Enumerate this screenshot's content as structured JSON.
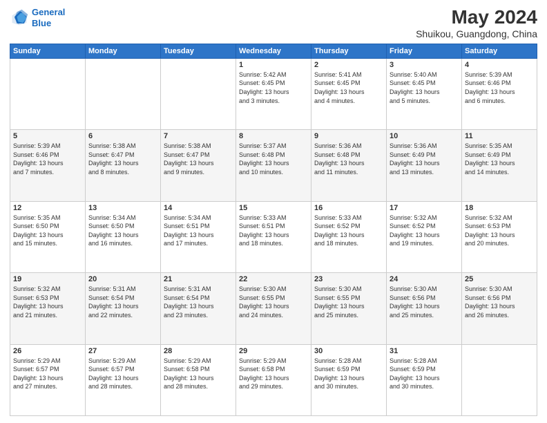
{
  "logo": {
    "line1": "General",
    "line2": "Blue"
  },
  "title": "May 2024",
  "subtitle": "Shuikou, Guangdong, China",
  "days_header": [
    "Sunday",
    "Monday",
    "Tuesday",
    "Wednesday",
    "Thursday",
    "Friday",
    "Saturday"
  ],
  "weeks": [
    [
      {
        "day": "",
        "info": ""
      },
      {
        "day": "",
        "info": ""
      },
      {
        "day": "",
        "info": ""
      },
      {
        "day": "1",
        "info": "Sunrise: 5:42 AM\nSunset: 6:45 PM\nDaylight: 13 hours\nand 3 minutes."
      },
      {
        "day": "2",
        "info": "Sunrise: 5:41 AM\nSunset: 6:45 PM\nDaylight: 13 hours\nand 4 minutes."
      },
      {
        "day": "3",
        "info": "Sunrise: 5:40 AM\nSunset: 6:45 PM\nDaylight: 13 hours\nand 5 minutes."
      },
      {
        "day": "4",
        "info": "Sunrise: 5:39 AM\nSunset: 6:46 PM\nDaylight: 13 hours\nand 6 minutes."
      }
    ],
    [
      {
        "day": "5",
        "info": "Sunrise: 5:39 AM\nSunset: 6:46 PM\nDaylight: 13 hours\nand 7 minutes."
      },
      {
        "day": "6",
        "info": "Sunrise: 5:38 AM\nSunset: 6:47 PM\nDaylight: 13 hours\nand 8 minutes."
      },
      {
        "day": "7",
        "info": "Sunrise: 5:38 AM\nSunset: 6:47 PM\nDaylight: 13 hours\nand 9 minutes."
      },
      {
        "day": "8",
        "info": "Sunrise: 5:37 AM\nSunset: 6:48 PM\nDaylight: 13 hours\nand 10 minutes."
      },
      {
        "day": "9",
        "info": "Sunrise: 5:36 AM\nSunset: 6:48 PM\nDaylight: 13 hours\nand 11 minutes."
      },
      {
        "day": "10",
        "info": "Sunrise: 5:36 AM\nSunset: 6:49 PM\nDaylight: 13 hours\nand 13 minutes."
      },
      {
        "day": "11",
        "info": "Sunrise: 5:35 AM\nSunset: 6:49 PM\nDaylight: 13 hours\nand 14 minutes."
      }
    ],
    [
      {
        "day": "12",
        "info": "Sunrise: 5:35 AM\nSunset: 6:50 PM\nDaylight: 13 hours\nand 15 minutes."
      },
      {
        "day": "13",
        "info": "Sunrise: 5:34 AM\nSunset: 6:50 PM\nDaylight: 13 hours\nand 16 minutes."
      },
      {
        "day": "14",
        "info": "Sunrise: 5:34 AM\nSunset: 6:51 PM\nDaylight: 13 hours\nand 17 minutes."
      },
      {
        "day": "15",
        "info": "Sunrise: 5:33 AM\nSunset: 6:51 PM\nDaylight: 13 hours\nand 18 minutes."
      },
      {
        "day": "16",
        "info": "Sunrise: 5:33 AM\nSunset: 6:52 PM\nDaylight: 13 hours\nand 18 minutes."
      },
      {
        "day": "17",
        "info": "Sunrise: 5:32 AM\nSunset: 6:52 PM\nDaylight: 13 hours\nand 19 minutes."
      },
      {
        "day": "18",
        "info": "Sunrise: 5:32 AM\nSunset: 6:53 PM\nDaylight: 13 hours\nand 20 minutes."
      }
    ],
    [
      {
        "day": "19",
        "info": "Sunrise: 5:32 AM\nSunset: 6:53 PM\nDaylight: 13 hours\nand 21 minutes."
      },
      {
        "day": "20",
        "info": "Sunrise: 5:31 AM\nSunset: 6:54 PM\nDaylight: 13 hours\nand 22 minutes."
      },
      {
        "day": "21",
        "info": "Sunrise: 5:31 AM\nSunset: 6:54 PM\nDaylight: 13 hours\nand 23 minutes."
      },
      {
        "day": "22",
        "info": "Sunrise: 5:30 AM\nSunset: 6:55 PM\nDaylight: 13 hours\nand 24 minutes."
      },
      {
        "day": "23",
        "info": "Sunrise: 5:30 AM\nSunset: 6:55 PM\nDaylight: 13 hours\nand 25 minutes."
      },
      {
        "day": "24",
        "info": "Sunrise: 5:30 AM\nSunset: 6:56 PM\nDaylight: 13 hours\nand 25 minutes."
      },
      {
        "day": "25",
        "info": "Sunrise: 5:30 AM\nSunset: 6:56 PM\nDaylight: 13 hours\nand 26 minutes."
      }
    ],
    [
      {
        "day": "26",
        "info": "Sunrise: 5:29 AM\nSunset: 6:57 PM\nDaylight: 13 hours\nand 27 minutes."
      },
      {
        "day": "27",
        "info": "Sunrise: 5:29 AM\nSunset: 6:57 PM\nDaylight: 13 hours\nand 28 minutes."
      },
      {
        "day": "28",
        "info": "Sunrise: 5:29 AM\nSunset: 6:58 PM\nDaylight: 13 hours\nand 28 minutes."
      },
      {
        "day": "29",
        "info": "Sunrise: 5:29 AM\nSunset: 6:58 PM\nDaylight: 13 hours\nand 29 minutes."
      },
      {
        "day": "30",
        "info": "Sunrise: 5:28 AM\nSunset: 6:59 PM\nDaylight: 13 hours\nand 30 minutes."
      },
      {
        "day": "31",
        "info": "Sunrise: 5:28 AM\nSunset: 6:59 PM\nDaylight: 13 hours\nand 30 minutes."
      },
      {
        "day": "",
        "info": ""
      }
    ]
  ]
}
